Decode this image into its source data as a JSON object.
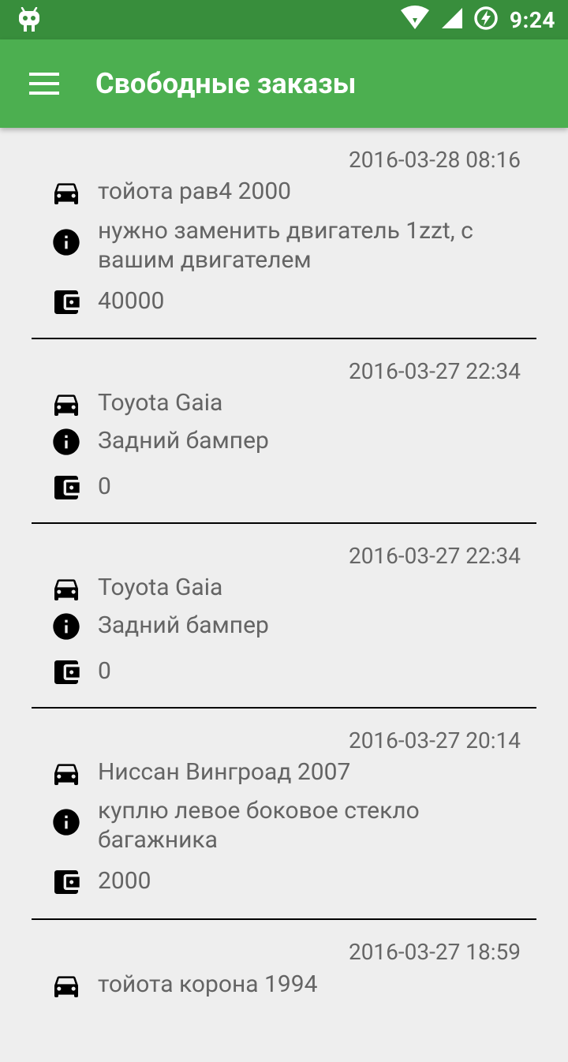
{
  "status_bar": {
    "time": "9:24",
    "icons": [
      "android-icon",
      "wifi-icon",
      "signal-icon",
      "battery-charging-icon"
    ]
  },
  "toolbar": {
    "title": "Свободные заказы",
    "menu_icon": "hamburger-menu-icon"
  },
  "colors": {
    "status_bar": "#388e3c",
    "toolbar": "#4caf50",
    "background": "#eeeeee",
    "text": "#646464",
    "date": "#666666"
  },
  "orders": [
    {
      "date": "2016-03-28 08:16",
      "car": "тойота  рав4 2000",
      "description": "нужно заменить двигатель 1zzt, с вашим двигателем",
      "price": "40000"
    },
    {
      "date": "2016-03-27 22:34",
      "car": "Toyota  Gaia",
      "description": "Задний бампер",
      "price": "0"
    },
    {
      "date": "2016-03-27 22:34",
      "car": "Toyota  Gaia",
      "description": "Задний бампер",
      "price": "0"
    },
    {
      "date": "2016-03-27 20:14",
      "car": "Ниссан  Вингроад  2007",
      "description": "куплю левое боковое стекло багажника",
      "price": "2000"
    },
    {
      "date": "2016-03-27 18:59",
      "car": "тойота корона 1994"
    }
  ]
}
